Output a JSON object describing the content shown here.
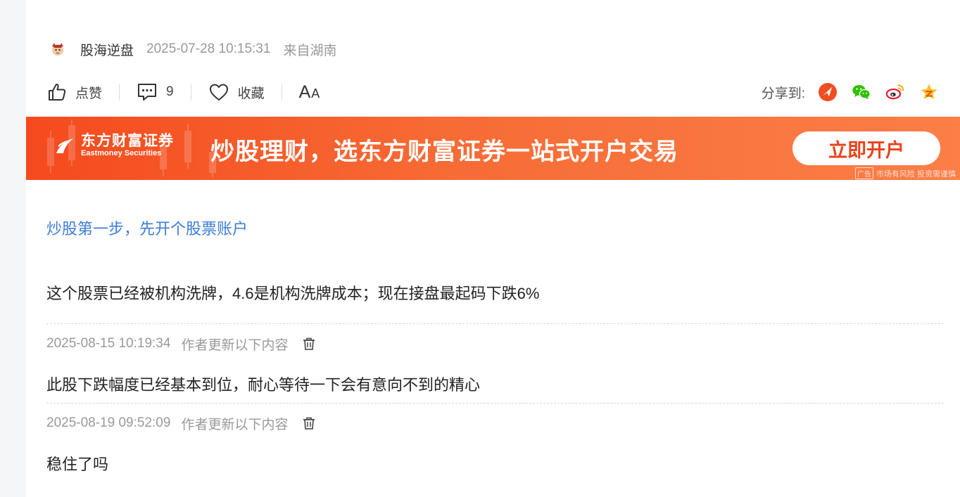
{
  "author": {
    "name": "股海逆盘",
    "post_time": "2025-07-28 10:15:31",
    "location": "来自湖南"
  },
  "actions": {
    "like_label": "点赞",
    "comment_count": "9",
    "favorite_label": "收藏",
    "font_big": "A",
    "font_small": "A"
  },
  "share": {
    "label": "分享到:",
    "targets": [
      "toutiao-icon",
      "wechat-icon",
      "weibo-icon",
      "qzone-icon"
    ]
  },
  "banner": {
    "brand_cn": "东方财富证券",
    "brand_en": "Eastmoney Securities",
    "slogan": "炒股理财，选东方财富证券一站式开户交易",
    "button": "立即开户",
    "ad_tag": "广告",
    "disclaimer": "市场有风险 投资需谨慎",
    "colors": {
      "start": "#f54a1e",
      "end": "#fb7f47"
    }
  },
  "promo_link": "炒股第一步，先开个股票账户",
  "post_body": "这个股票已经被机构洗牌，4.6是机构洗牌成本；现在接盘最起码下跌6%",
  "updates": [
    {
      "time": "2025-08-15 10:19:34",
      "label": "作者更新以下内容",
      "text": "此股下跌幅度已经基本到位，耐心等待一下会有意向不到的精心"
    },
    {
      "time": "2025-08-19 09:52:09",
      "label": "作者更新以下内容",
      "text": "稳住了吗"
    }
  ],
  "colors": {
    "link": "#3d7cd8",
    "meta_gray": "#999999"
  }
}
